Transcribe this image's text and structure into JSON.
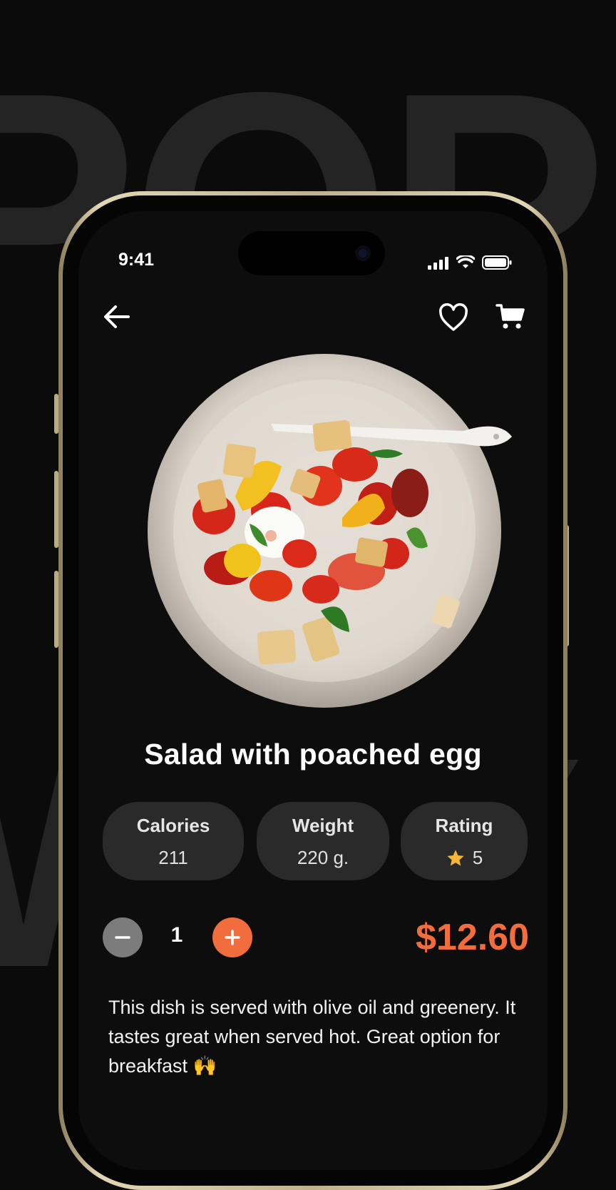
{
  "status": {
    "time": "9:41"
  },
  "product": {
    "title": "Salad with poached egg",
    "stats": [
      {
        "label": "Calories",
        "value": "211"
      },
      {
        "label": "Weight",
        "value": "220 g."
      },
      {
        "label": "Rating",
        "value": "5",
        "icon": "star-icon"
      }
    ],
    "quantity": "1",
    "price": "$12.60",
    "description": "This dish is served with olive oil and greenery. It tastes great when served hot. Great option for breakfast 🙌"
  },
  "colors": {
    "accent": "#f26d3d",
    "background": "#0d0d0d",
    "card": "#2a2a2a",
    "star": "#f5b731"
  },
  "icons": {
    "back": "arrow-left-icon",
    "favorite": "heart-icon",
    "cart": "cart-icon",
    "minus": "minus-icon",
    "plus": "plus-icon"
  }
}
